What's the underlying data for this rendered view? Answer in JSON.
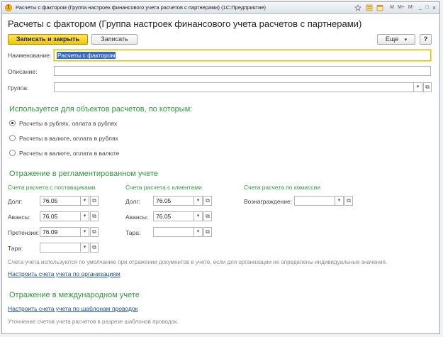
{
  "window": {
    "title": "Расчеты с фактором (Группа настроек финансового учета расчетов с партнерами) (1С:Предприятие)",
    "toolbar_icons": [
      "star-icon",
      "list-icon",
      "calendar-icon"
    ],
    "toolbar_text": [
      "M",
      "M+",
      "M-"
    ],
    "min_label": "_",
    "max_label": "□",
    "close_label": "×"
  },
  "header": {
    "title": "Расчеты с фактором (Группа настроек финансового учета расчетов с партнерами)",
    "save_close": "Записать и закрыть",
    "save": "Записать",
    "more": "Еще",
    "more_arrow": "▾",
    "help": "?"
  },
  "form": {
    "name_label": "Наименование:",
    "name_value": "Расчеты с фактором",
    "description_label": "Описание:",
    "description_value": "",
    "group_label": "Группа:",
    "group_value": ""
  },
  "usage": {
    "heading": "Используется для объектов расчетов, по которым:",
    "options": [
      {
        "label": "Расчеты в рублях, оплата в рублях",
        "selected": true
      },
      {
        "label": "Расчеты в валюте, оплата в рублях",
        "selected": false
      },
      {
        "label": "Расчеты в валюте, оплата в валюте",
        "selected": false
      }
    ]
  },
  "regulated": {
    "heading": "Отражение в регламентированном учете",
    "suppliers": {
      "title": "Счета расчета с поставщиками",
      "debt_label": "Долг:",
      "debt_value": "76.05",
      "advance_label": "Авансы:",
      "advance_value": "76.05",
      "claims_label": "Претензии:",
      "claims_value": "76.09",
      "tare_label": "Тара:",
      "tare_value": ""
    },
    "customers": {
      "title": "Счета расчета с клиентами",
      "debt_label": "Долг:",
      "debt_value": "76.05",
      "advance_label": "Авансы:",
      "advance_value": "76.05",
      "tare_label": "Тара:",
      "tare_value": ""
    },
    "commission": {
      "title": "Счета расчета по комиссии",
      "reward_label": "Вознаграждение:",
      "reward_value": ""
    },
    "note": "Счета учета используются по умолчанию при отражении документов в учете, если для организации не определены индивидуальные значения.",
    "link": "Настроить счета учета по организациям"
  },
  "international": {
    "heading": "Отражение в международном учете",
    "link": "Настроить счета учета по шаблонам проводок",
    "note": "Уточнение счетов учета расчетов в разрезе шаблонов проводок."
  }
}
